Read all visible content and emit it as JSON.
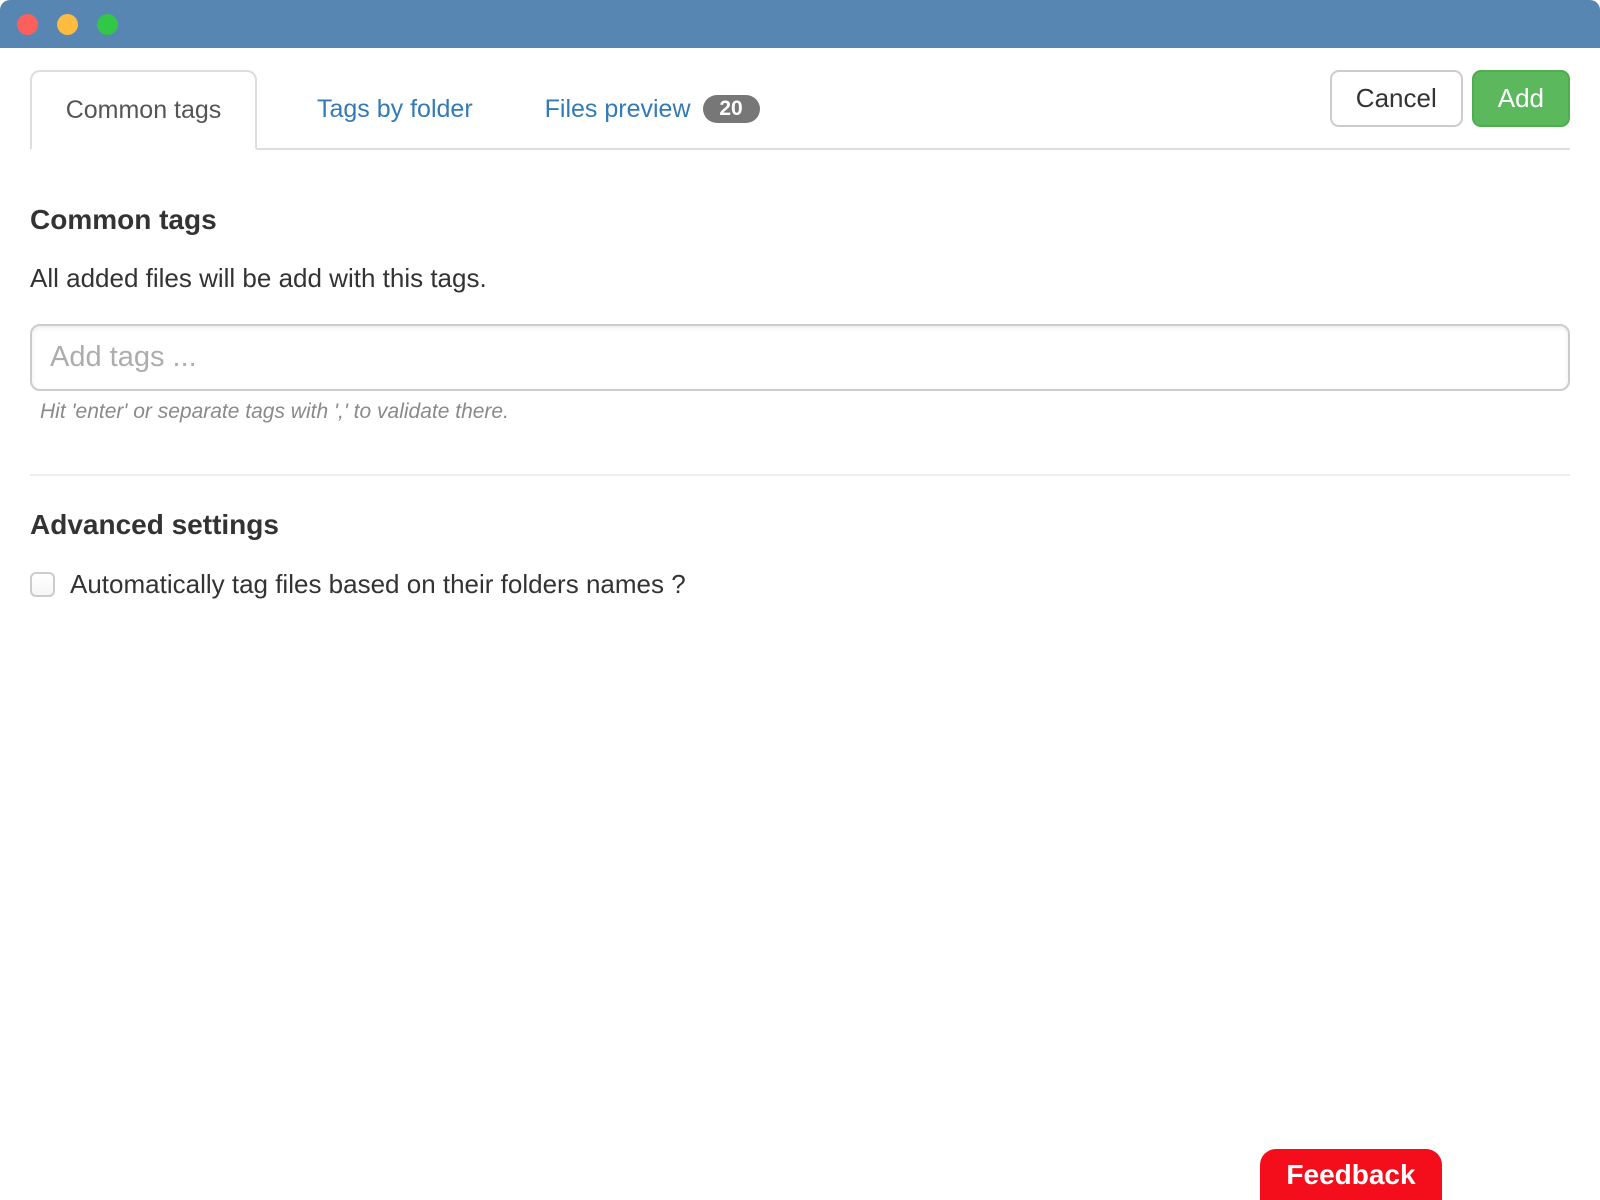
{
  "window": {
    "titlebar_color": "#5886b2",
    "traffic_lights": {
      "close_color": "#fb605d",
      "minimize_color": "#fdbc40",
      "zoom_color": "#33c748"
    }
  },
  "tabs": [
    {
      "label": "Common tags",
      "active": true
    },
    {
      "label": "Tags by folder",
      "active": false
    },
    {
      "label": "Files preview",
      "active": false,
      "badge": "20"
    }
  ],
  "actions": {
    "cancel_label": "Cancel",
    "add_label": "Add"
  },
  "common_tags_section": {
    "heading": "Common tags",
    "description": "All added files will be add with this tags.",
    "input_placeholder": "Add tags ...",
    "input_value": "",
    "helper_text": "Hit 'enter' or separate tags with ',' to validate there."
  },
  "advanced_settings_section": {
    "heading": "Advanced settings",
    "checkbox": {
      "label": "Automatically tag files based on their folders names ?",
      "checked": false
    }
  },
  "feedback": {
    "label": "Feedback",
    "color": "#f40d1b"
  },
  "colors": {
    "tab_link": "#337ab7",
    "tab_active_text": "#555555",
    "badge_bg": "#777777",
    "add_button_bg": "#5cb85c",
    "border": "#dddddd"
  }
}
